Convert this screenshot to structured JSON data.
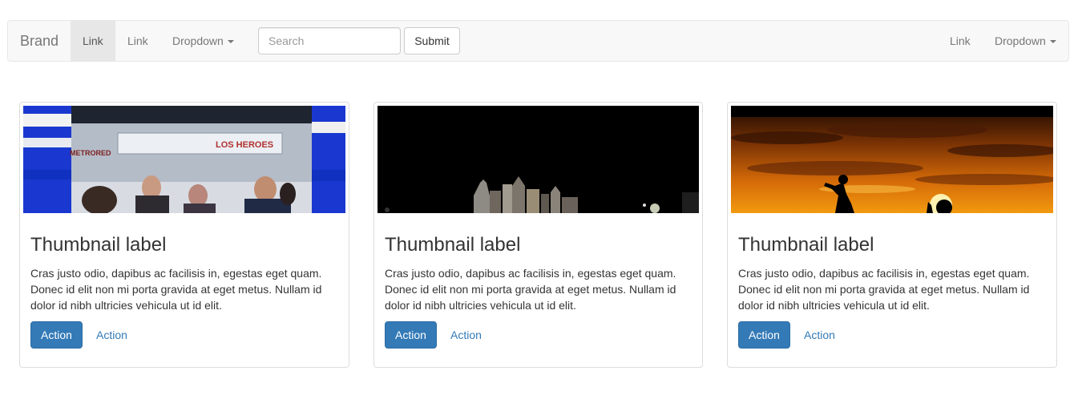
{
  "navbar": {
    "brand": "Brand",
    "left_links": [
      {
        "label": "Link",
        "active": true
      },
      {
        "label": "Link",
        "active": false
      }
    ],
    "left_dropdown": "Dropdown",
    "search": {
      "placeholder": "Search",
      "value": ""
    },
    "submit_label": "Submit",
    "right_link": "Link",
    "right_dropdown": "Dropdown"
  },
  "thumbnails": [
    {
      "image": "subway-station-people",
      "title": "Thumbnail label",
      "text": "Cras justo odio, dapibus ac facilisis in, egestas eget quam. Donec id elit non mi porta gravida at eget metus. Nullam id dolor id nibh ultricies vehicula ut id elit.",
      "primary_action": "Action",
      "secondary_action": "Action",
      "image_text": {
        "sign_left": "METRORED",
        "sign_right": "LOS HEROES"
      }
    },
    {
      "image": "night-city-skyline",
      "title": "Thumbnail label",
      "text": "Cras justo odio, dapibus ac facilisis in, egestas eget quam. Donec id elit non mi porta gravida at eget metus. Nullam id dolor id nibh ultricies vehicula ut id elit.",
      "primary_action": "Action",
      "secondary_action": "Action"
    },
    {
      "image": "sunset-silhouette",
      "title": "Thumbnail label",
      "text": "Cras justo odio, dapibus ac facilisis in, egestas eget quam. Donec id elit non mi porta gravida at eget metus. Nullam id dolor id nibh ultricies vehicula ut id elit.",
      "primary_action": "Action",
      "secondary_action": "Action"
    }
  ],
  "colors": {
    "navbar_bg": "#f8f8f8",
    "navbar_border": "#e7e7e7",
    "active_link_bg": "#e7e7e7",
    "primary": "#337ab7",
    "text": "#333333",
    "muted": "#777777"
  }
}
